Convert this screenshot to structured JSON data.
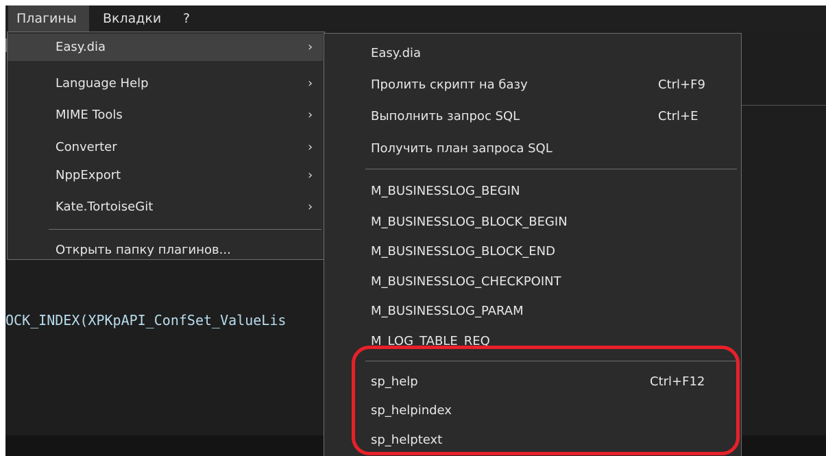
{
  "menubar": {
    "items": [
      {
        "label": "Плагины",
        "active": true
      },
      {
        "label": "Вкладки",
        "active": false
      },
      {
        "label": "?",
        "active": false
      }
    ]
  },
  "editor": {
    "code_fragment": "OCK_INDEX(XPKpAPI_ConfSet_ValueLis"
  },
  "plugins_menu": {
    "items": [
      {
        "label": "Easy.dia",
        "has_submenu": true,
        "hovered": true
      },
      {
        "label": "Language Help",
        "has_submenu": true
      },
      {
        "label": "MIME Tools",
        "has_submenu": true
      },
      {
        "label": "Converter",
        "has_submenu": true
      },
      {
        "label": "NppExport",
        "has_submenu": true
      },
      {
        "label": "Kate.TortoiseGit",
        "has_submenu": true
      }
    ],
    "open_folder_label": "Открыть папку плагинов...",
    "submenu_arrow": "›"
  },
  "easydia_menu": {
    "group1": [
      {
        "label": "Easy.dia",
        "shortcut": ""
      },
      {
        "label": "Пролить скрипт на базу",
        "shortcut": "Ctrl+F9"
      },
      {
        "label": "Выполнить запрос SQL",
        "shortcut": "Ctrl+E"
      },
      {
        "label": "Получить план запроса SQL",
        "shortcut": ""
      }
    ],
    "group2": [
      {
        "label": "M_BUSINESSLOG_BEGIN"
      },
      {
        "label": "M_BUSINESSLOG_BLOCK_BEGIN"
      },
      {
        "label": "M_BUSINESSLOG_BLOCK_END"
      },
      {
        "label": "M_BUSINESSLOG_CHECKPOINT"
      },
      {
        "label": "M_BUSINESSLOG_PARAM"
      },
      {
        "label": "M_LOG_TABLE_REQ"
      }
    ],
    "group3": [
      {
        "label": "sp_help",
        "shortcut": "Ctrl+F12"
      },
      {
        "label": "sp_helpindex",
        "shortcut": ""
      },
      {
        "label": "sp_helptext",
        "shortcut": ""
      }
    ]
  },
  "colors": {
    "background": "#1e1e1e",
    "menu_bg": "#2b2b2b",
    "menu_hover": "#414141",
    "highlight_annotation": "#e8202a"
  }
}
